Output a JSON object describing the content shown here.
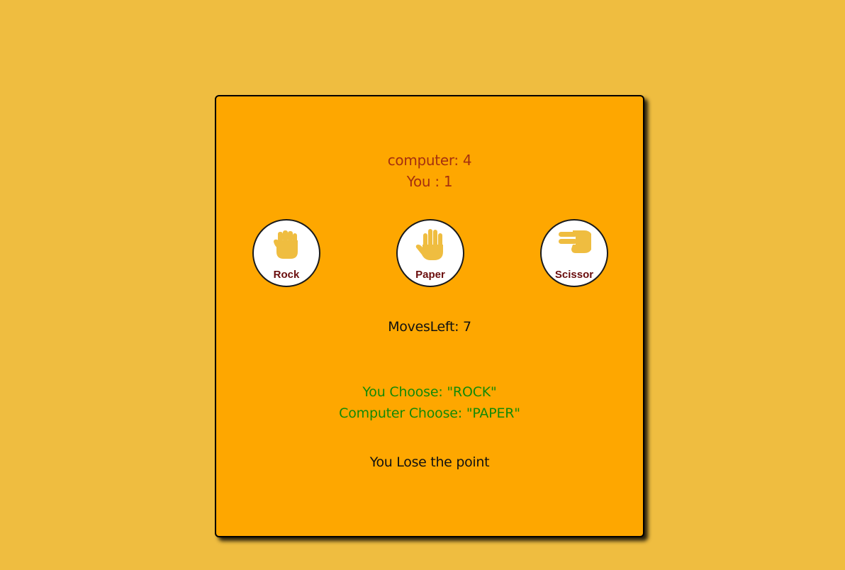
{
  "scoreboard": {
    "computer": "computer: 4",
    "you": "You : 1"
  },
  "choices": [
    {
      "label": "Rock",
      "icon": "fist-icon"
    },
    {
      "label": "Paper",
      "icon": "raised-hand-icon"
    },
    {
      "label": "Scissor",
      "icon": "victory-hand-icon"
    }
  ],
  "moves": {
    "label": "MovesLeft:",
    "value": "7"
  },
  "last_round": {
    "you_choose": "You Choose: \"ROCK\"",
    "computer_choose": "Computer Choose: \"PAPER\""
  },
  "result": "You Lose the point",
  "colors": {
    "background": "#efbd40",
    "board": "#fea700",
    "icon": "#efbd40",
    "score_text": "#a5300f",
    "choice_text": "#138a07",
    "label_text": "#6a0d0d"
  }
}
